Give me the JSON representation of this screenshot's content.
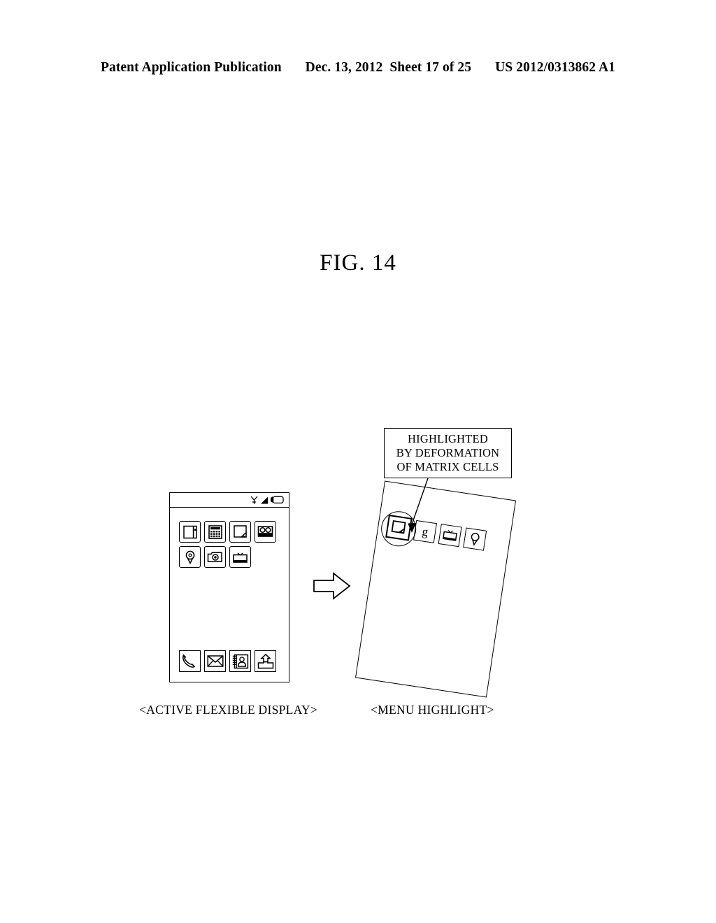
{
  "header": {
    "publication": "Patent Application Publication",
    "date": "Dec. 13, 2012",
    "sheet": "Sheet 17 of 25",
    "patent_number": "US 2012/0313862 A1"
  },
  "figure": {
    "title": "FIG. 14"
  },
  "callout": {
    "line1": "HIGHLIGHTED",
    "line2": "BY DEFORMATION",
    "line3": "OF MATRIX CELLS"
  },
  "left_device": {
    "caption": "<ACTIVE FLEXIBLE DISPLAY>",
    "statusbar": {
      "icons": [
        "antenna-icon",
        "signal-bars-icon",
        "battery-icon"
      ]
    },
    "grid_icons": [
      {
        "name": "notebook-icon",
        "label": "Notebook"
      },
      {
        "name": "calculator-icon",
        "label": "Calculator"
      },
      {
        "name": "photo-icon",
        "label": "Photo"
      },
      {
        "name": "film-projector-icon",
        "label": "Video"
      },
      {
        "name": "location-pin-icon",
        "label": "Maps"
      },
      {
        "name": "camera-icon",
        "label": "Camera"
      },
      {
        "name": "tv-icon",
        "label": "TV"
      }
    ],
    "dock_icons": [
      {
        "name": "phone-handset-icon",
        "label": "Phone"
      },
      {
        "name": "envelope-icon",
        "label": "Messages"
      },
      {
        "name": "contacts-icon",
        "label": "Contacts"
      },
      {
        "name": "upload-home-icon",
        "label": "Home"
      }
    ]
  },
  "right_device": {
    "caption": "<MENU HIGHLIGHT>",
    "rotation_degrees": 8.5,
    "icons": [
      {
        "name": "photo-icon",
        "label": "Photo",
        "highlighted": true
      },
      {
        "name": "letter-g-icon",
        "label": "g",
        "highlighted": false
      },
      {
        "name": "tv-icon",
        "label": "TV",
        "highlighted": false
      },
      {
        "name": "location-pin-icon",
        "label": "Maps",
        "highlighted": false
      }
    ]
  },
  "transition": {
    "arrow": "right-arrow-icon"
  },
  "colors": {
    "ink": "#000000",
    "paper": "#ffffff"
  }
}
